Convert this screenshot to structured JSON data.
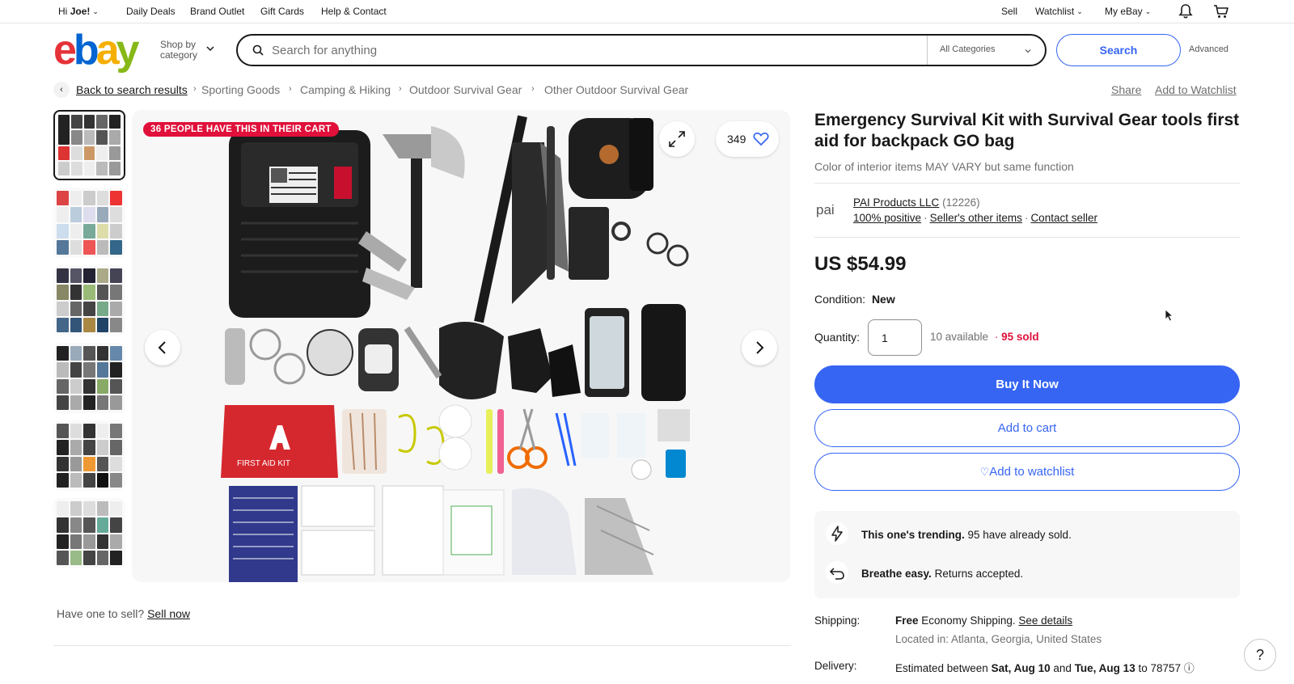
{
  "topbar": {
    "greeting_prefix": "Hi",
    "greeting_name": "Joe!",
    "links": [
      "Daily Deals",
      "Brand Outlet",
      "Gift Cards",
      "Help & Contact"
    ],
    "sell": "Sell",
    "watchlist": "Watchlist",
    "my_ebay": "My eBay"
  },
  "header": {
    "logo_letters": [
      "e",
      "b",
      "a",
      "y"
    ],
    "logo_colors": [
      "#e53238",
      "#0064d2",
      "#f5af02",
      "#86b817"
    ],
    "shop_by_line1": "Shop by",
    "shop_by_line2": "category",
    "search_placeholder": "Search for anything",
    "category_select": "All Categories",
    "search_button": "Search",
    "advanced": "Advanced"
  },
  "breadcrumb": {
    "back": "Back to search results",
    "items": [
      "Sporting Goods",
      "Camping & Hiking",
      "Outdoor Survival Gear",
      "Other Outdoor Survival Gear"
    ],
    "share": "Share",
    "add_to_watchlist": "Add to Watchlist"
  },
  "gallery": {
    "cart_badge": "36 PEOPLE HAVE THIS IN THEIR CART",
    "watch_count": "349",
    "kit_labels": [
      "FIRST AID KIT"
    ]
  },
  "sell_prompt": {
    "text": "Have one to sell?",
    "link": "Sell now"
  },
  "product": {
    "title": "Emergency Survival Kit with Survival Gear tools first aid for backpack GO bag",
    "subtitle": "Color of interior items MAY VARY but same function",
    "seller_logo_text": "pai",
    "seller_name": "PAI Products LLC",
    "seller_feedback": "(12226)",
    "seller_positive": "100% positive",
    "seller_other": "Seller's other items",
    "contact_seller": "Contact seller",
    "price": "US $54.99",
    "condition_label": "Condition:",
    "condition_value": "New",
    "quantity_label": "Quantity:",
    "quantity_value": "1",
    "available": "10 available",
    "sold": "95 sold",
    "buy_now": "Buy It Now",
    "add_to_cart": "Add to cart",
    "add_to_watchlist": "Add to watchlist",
    "trending_bold": "This one's trending.",
    "trending_rest": "95 have already sold.",
    "returns_bold": "Breathe easy.",
    "returns_rest": "Returns accepted.",
    "shipping_label": "Shipping:",
    "shipping_free": "Free",
    "shipping_method": "Economy Shipping.",
    "see_details": "See details",
    "located": "Located in: Atlanta, Georgia, United States",
    "delivery_label": "Delivery:",
    "delivery_prefix": "Estimated between",
    "delivery_start": "Sat, Aug 10",
    "delivery_and": "and",
    "delivery_end": "Tue, Aug 13",
    "delivery_to": "to 78757"
  },
  "help": "?"
}
